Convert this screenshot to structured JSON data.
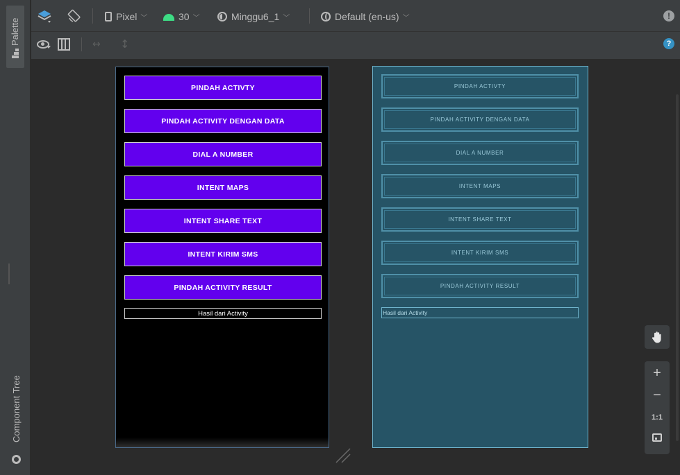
{
  "sidebar": {
    "palette_label": "Palette",
    "component_tree_label": "Component Tree"
  },
  "toolbar": {
    "device": "Pixel",
    "api_level": "30",
    "theme": "Minggu6_1",
    "locale": "Default (en-us)",
    "icons": [
      "layers-icon",
      "orientation-icon",
      "phone-icon",
      "android-icon",
      "theme-icon",
      "globe-icon",
      "warning-icon"
    ]
  },
  "toolbar2": {
    "icons": [
      "eye-icon",
      "columns-icon",
      "horizontal-arrows-icon",
      "vertical-arrows-icon",
      "help-icon"
    ]
  },
  "design": {
    "buttons": [
      "PINDAH ACTIVTY",
      "PINDAH ACTIVITY DENGAN DATA",
      "DIAL A NUMBER",
      "INTENT MAPS",
      "INTENT SHARE TEXT",
      "INTENT KIRIM SMS",
      "PINDAH ACTIVITY RESULT"
    ],
    "result_text": "Hasil dari Activity"
  },
  "blueprint": {
    "buttons": [
      "PINDAH ACTIVTY",
      "PINDAH ACTIVITY DENGAN DATA",
      "DIAL A NUMBER",
      "INTENT MAPS",
      "INTENT SHARE TEXT",
      "INTENT KIRIM SMS",
      "PINDAH ACTIVITY RESULT"
    ],
    "result_text": "Hasil dari Activity"
  },
  "zoom": {
    "zoom_in": "+",
    "zoom_out": "−",
    "actual_size": "1:1"
  },
  "colors": {
    "button_purple": "#6200ee",
    "blueprint_bg": "#265466",
    "android_green": "#3ddc84",
    "help_blue": "#3592c4"
  }
}
